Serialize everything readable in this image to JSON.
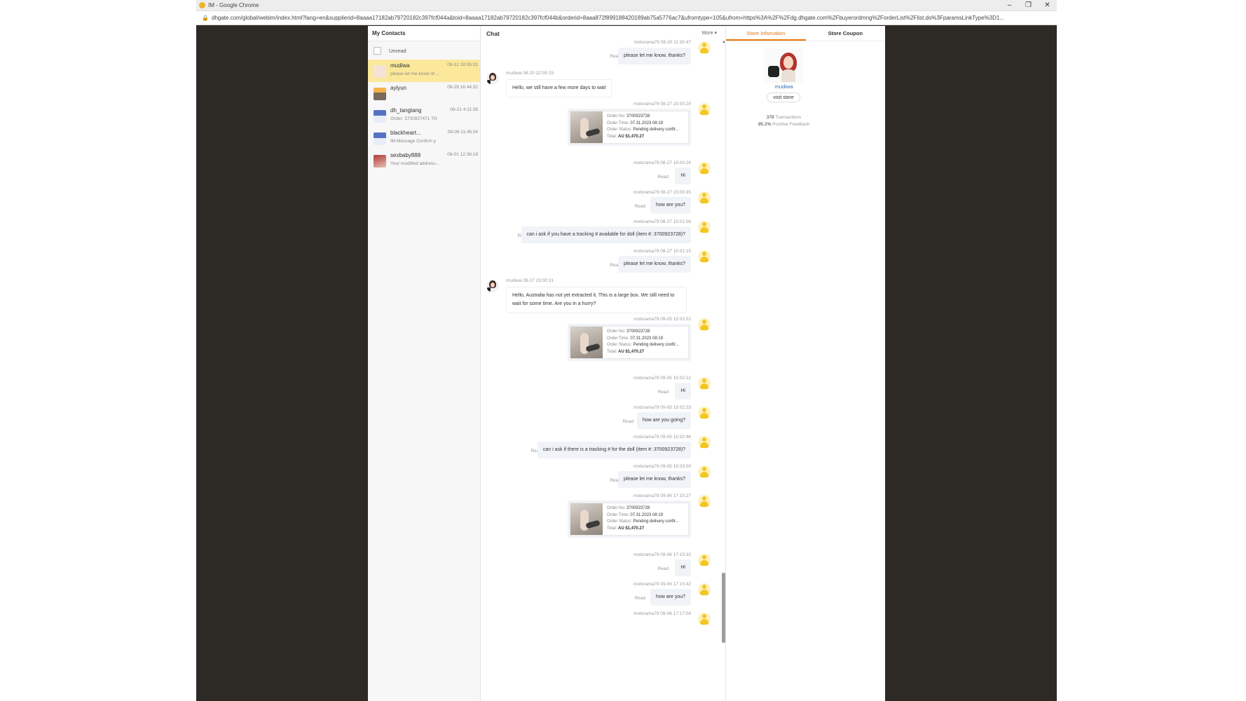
{
  "browser": {
    "window_title": "IM - Google Chrome",
    "url": "dhgate.com/global/webim/index.html?lang=en&supplierid=8aaaa17182ab79720182c397fcf044a&toid=8aaaa17182ab79720182c397fcf044b&orderid=8aaa872f899188420189ab75a5776ac7&ufromtype=105&ufrom=https%3A%2F%2Fdg.dhgate.com%2Fbuyerordmng%2ForderList%2Flist.do%3FparamsLinkType%3D1..."
  },
  "contacts": {
    "header": "My Contacts",
    "unread_label": "Unread",
    "items": [
      {
        "name": "mudiwa",
        "time": "09-12 18:05:31",
        "preview": "please let me know of ..."
      },
      {
        "name": "aylyun",
        "time": "08-29 16:44:32",
        "preview": ""
      },
      {
        "name": "dh_tangtang",
        "time": "08-21 4:11:38",
        "preview": "Order: 3700927471 TN"
      },
      {
        "name": "blackheart...",
        "time": "08-06 11:46:34",
        "preview": "IM Message Confirm y"
      },
      {
        "name": "sexbaby888",
        "time": "08-01 12:36:18",
        "preview": "Your modified address..."
      }
    ]
  },
  "chat": {
    "header": "Chat",
    "more_label": "More ▾",
    "messages": [
      {
        "meta": "motorama79 08-20 11:30:47",
        "text": "please let me know, thanks?",
        "read": "Read"
      },
      {
        "meta": "mudiwa 08-20 22:05:33",
        "text": "Hello, we still have a few more days to wait"
      },
      {
        "meta": "motorama79 08-27 15:00:20"
      },
      {
        "meta": "motorama79 08-27 15:00:24",
        "text": "Hi",
        "read": "Read"
      },
      {
        "meta": "motorama79 08-27 15:00:35",
        "text": "how are you?",
        "read": "Read"
      },
      {
        "meta": "motorama79 08-27 15:01:08",
        "text": "can i ask if you have a tracking # available for doll (item #: 3700923728)?",
        "read": "Read"
      },
      {
        "meta": "motorama79 08-27 15:01:15",
        "text": "please let me know, thanks?",
        "read": "Read"
      },
      {
        "meta": "mudiwa 08-27 23:00:31",
        "text": "Hello, Australia has not yet extracted it. This is a large box. We still need to wait for some time. Are you in a hurry?"
      },
      {
        "meta": "motorama79 09-05 15:02:01"
      },
      {
        "meta": "motorama79 09-05 15:02:12",
        "text": "Hi",
        "read": "Read"
      },
      {
        "meta": "motorama79 09-05 15:02:23",
        "text": "how are you going?",
        "read": "Read"
      },
      {
        "meta": "motorama79 09-05 15:02:46",
        "text": "can i ask if there is a tracking # for the doll (item #: 3700923728)?",
        "read": "Read"
      },
      {
        "meta": "motorama79 09-05 15:03:00",
        "text": "please let me know, thanks?",
        "read": "Read"
      },
      {
        "meta": "motorama79 09-06 17:15:27"
      },
      {
        "meta": "motorama79 09-06 17:15:32",
        "text": "Hi",
        "read": "Read"
      },
      {
        "meta": "motorama79 09-06 17:15:42",
        "text": "how are you?",
        "read": "Read"
      },
      {
        "meta": "motorama79 09-06 17:17:04"
      }
    ],
    "order": {
      "no_label": "Order No:",
      "no_value": "3700923728",
      "time_label": "Order Time:",
      "time_value": "07.31.2023 08:19",
      "status_label": "Order Status:",
      "status_value": "Pending delivery confir...",
      "total_label": "Total:",
      "total_value": "AU $1,470.27"
    }
  },
  "store": {
    "tab_info": "Store Infomation",
    "tab_coupon": "Store Coupon",
    "name": "mudiwa",
    "visit_label": "visit store",
    "transactions_value": "378",
    "transactions_label": "Transactions",
    "feedback_value": "95.2%",
    "feedback_label": "Positive Feedback"
  }
}
